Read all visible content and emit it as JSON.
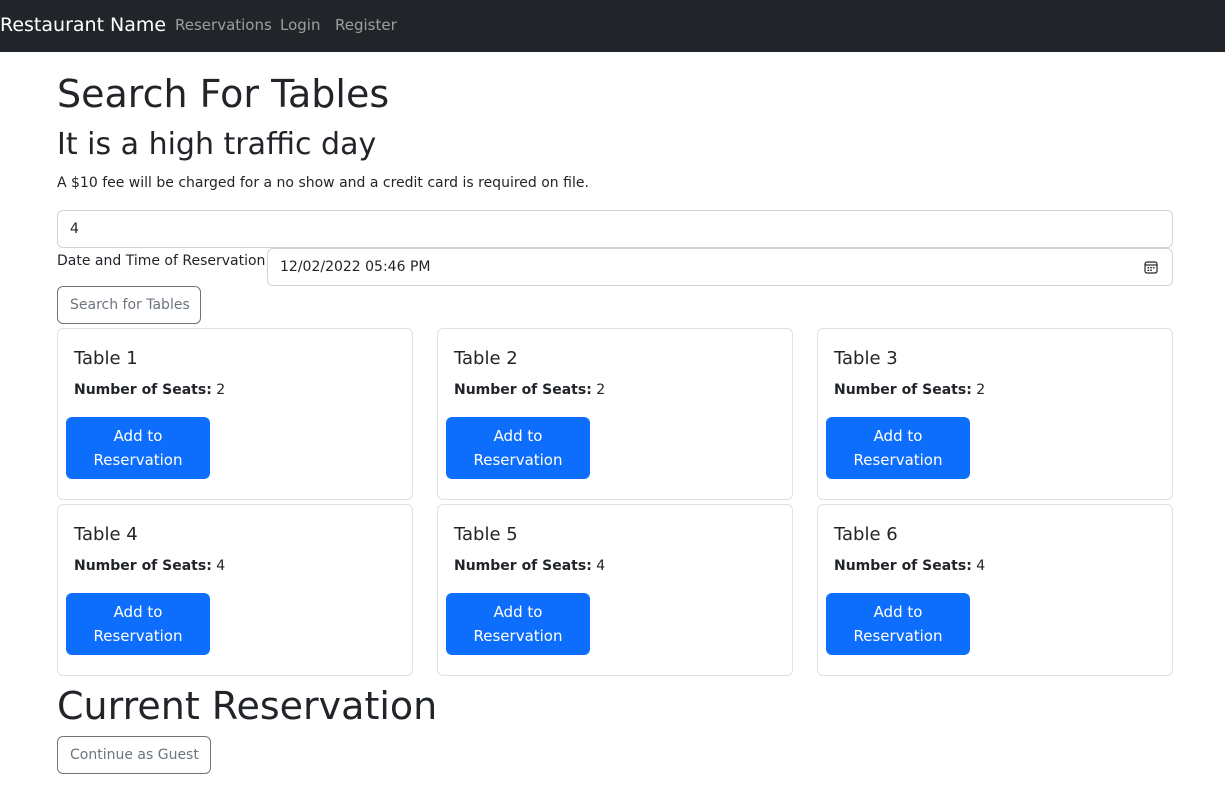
{
  "navbar": {
    "brand": "Restaurant Name",
    "links": [
      "Reservations",
      "Login",
      "Register"
    ],
    "background": "#212529"
  },
  "search": {
    "heading": "Search For Tables",
    "subheading": "It is a high traffic day",
    "notice": "A $10 fee will be charged for a no show and a credit card is required on file.",
    "party_size_value": "4",
    "date_label": "Date and Time of Reservation:",
    "date_value": "12/02/2022 05:46  PM",
    "search_button": "Search for Tables"
  },
  "tables": [
    {
      "title": "Table 1",
      "seats_label": "Number of Seats:",
      "seats": "2",
      "button_line1": "Add to",
      "button_line2": "Reservation"
    },
    {
      "title": "Table 2",
      "seats_label": "Number of Seats:",
      "seats": "2",
      "button_line1": "Add to",
      "button_line2": "Reservation"
    },
    {
      "title": "Table 3",
      "seats_label": "Number of Seats:",
      "seats": "2",
      "button_line1": "Add to",
      "button_line2": "Reservation"
    },
    {
      "title": "Table 4",
      "seats_label": "Number of Seats:",
      "seats": "4",
      "button_line1": "Add to",
      "button_line2": "Reservation"
    },
    {
      "title": "Table 5",
      "seats_label": "Number of Seats:",
      "seats": "4",
      "button_line1": "Add to",
      "button_line2": "Reservation"
    },
    {
      "title": "Table 6",
      "seats_label": "Number of Seats:",
      "seats": "4",
      "button_line1": "Add to",
      "button_line2": "Reservation"
    }
  ],
  "current": {
    "heading": "Current Reservation",
    "guest_button": "Continue as Guest"
  },
  "colors": {
    "primary": "#0d6efd",
    "secondary": "#6c757d",
    "border": "#dee2e6"
  },
  "icons": {
    "date_picker": "calendar-icon"
  }
}
